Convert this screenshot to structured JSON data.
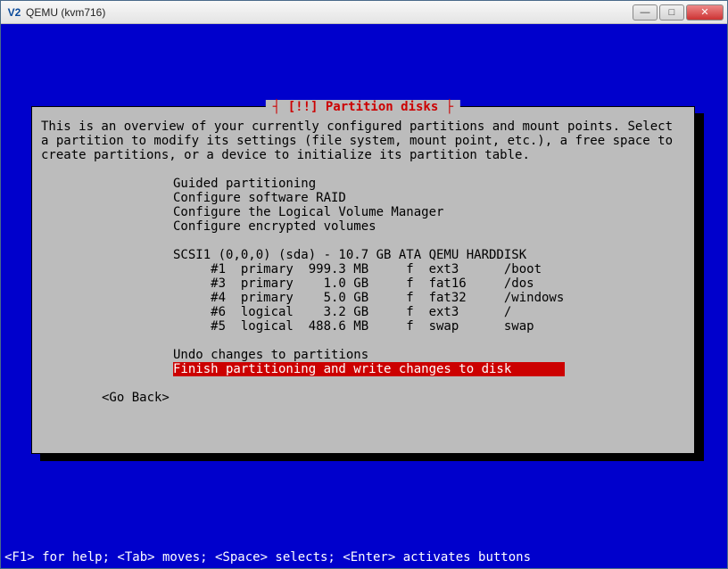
{
  "window": {
    "app_icon_text": "V2",
    "title": "QEMU (kvm716)",
    "buttons": {
      "min": "—",
      "max": "□",
      "close": "✕"
    }
  },
  "dialog": {
    "title": "┤ [!!] Partition disks ├",
    "intro": "This is an overview of your currently configured partitions and mount points. Select a partition to modify its settings (file system, mount point, etc.), a free space to create partitions, or a device to initialize its partition table.",
    "menu_top": [
      "Guided partitioning",
      "Configure software RAID",
      "Configure the Logical Volume Manager",
      "Configure encrypted volumes"
    ],
    "disk_header": "SCSI1 (0,0,0) (sda) - 10.7 GB ATA QEMU HARDDISK",
    "partitions": [
      "     #1  primary  999.3 MB     f  ext3      /boot",
      "     #3  primary    1.0 GB     f  fat16     /dos",
      "     #4  primary    5.0 GB     f  fat32     /windows",
      "     #6  logical    3.2 GB     f  ext3      /",
      "     #5  logical  488.6 MB     f  swap      swap"
    ],
    "menu_bottom": [
      "Undo changes to partitions",
      "Finish partitioning and write changes to disk"
    ],
    "selected": "Finish partitioning and write changes to disk",
    "go_back": "<Go Back>"
  },
  "helpbar": "<F1> for help; <Tab> moves; <Space> selects; <Enter> activates buttons"
}
